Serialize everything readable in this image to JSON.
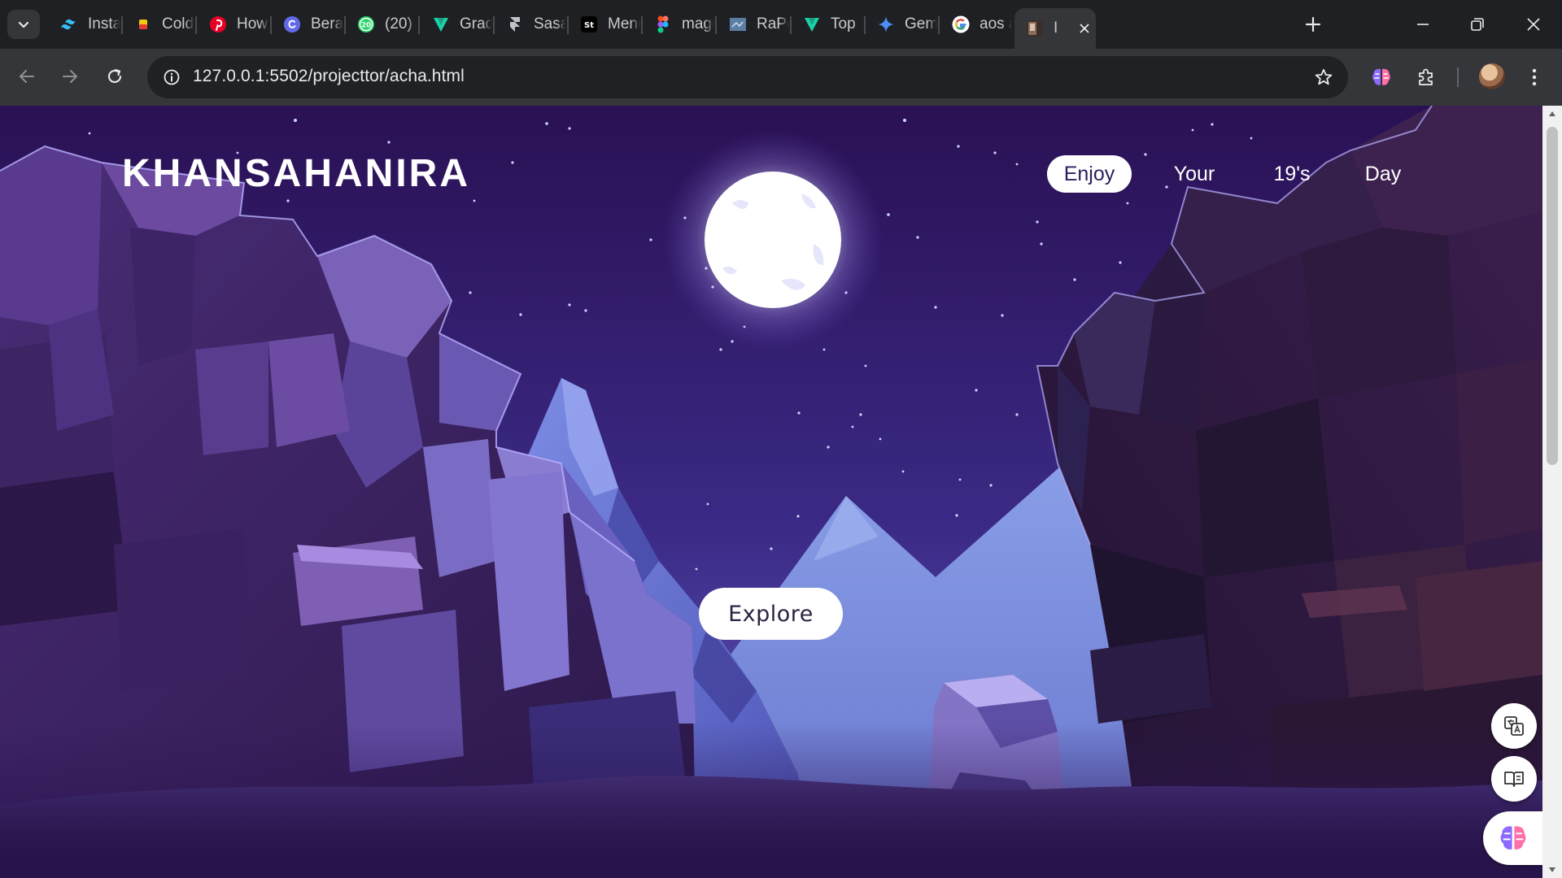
{
  "browser": {
    "tabs": [
      {
        "label": "Insta",
        "favicon": "tailwind-icon",
        "color": "#38bdf8"
      },
      {
        "label": "Cold",
        "favicon": "coldplay-icon",
        "color": "#f2c811"
      },
      {
        "label": "How",
        "favicon": "pinterest-icon",
        "color": "#e60023"
      },
      {
        "label": "Bera",
        "favicon": "canva-icon",
        "color": "#7d2ae8"
      },
      {
        "label": "(20)",
        "favicon": "whatsapp-icon",
        "color": "#25d366"
      },
      {
        "label": "Grad",
        "favicon": "vuetify-icon",
        "color": "#1bd1a5"
      },
      {
        "label": "Sasa",
        "favicon": "framer-icon",
        "color": "#bfc3c8"
      },
      {
        "label": "Menu",
        "favicon": "stripe-st-icon",
        "color": "#000000"
      },
      {
        "label": "magi",
        "favicon": "figma-icon",
        "color": "#f24e1e"
      },
      {
        "label": "RaPo",
        "favicon": "rapo-icon",
        "color": "#5b7fa3"
      },
      {
        "label": "Top",
        "favicon": "vuetify-icon",
        "color": "#1bd1a5"
      },
      {
        "label": "Gem",
        "favicon": "gemini-icon",
        "color": "#4e8cf7"
      },
      {
        "label": "aos a",
        "favicon": "google-icon",
        "color": "#4285f4"
      },
      {
        "label": "I",
        "favicon": "page-thumbnail-icon",
        "color": "#8a6a5a",
        "active": true
      }
    ],
    "url": "127.0.0.1:5502/projecttor/acha.html"
  },
  "page": {
    "logo": "KHANSAHANIRA",
    "nav": [
      {
        "label": "Enjoy",
        "active": true
      },
      {
        "label": "Your",
        "active": false
      },
      {
        "label": "19's",
        "active": false
      },
      {
        "label": "Day",
        "active": false
      }
    ],
    "explore_label": "Explore",
    "colors": {
      "sky_top": "#2b1357",
      "sky_bottom": "#5a46a8",
      "moon": "#ffffff",
      "cliff_dark": "#2a1640",
      "cliff_mid": "#5b3a8a",
      "mountain_light": "#7f8fe6"
    }
  }
}
